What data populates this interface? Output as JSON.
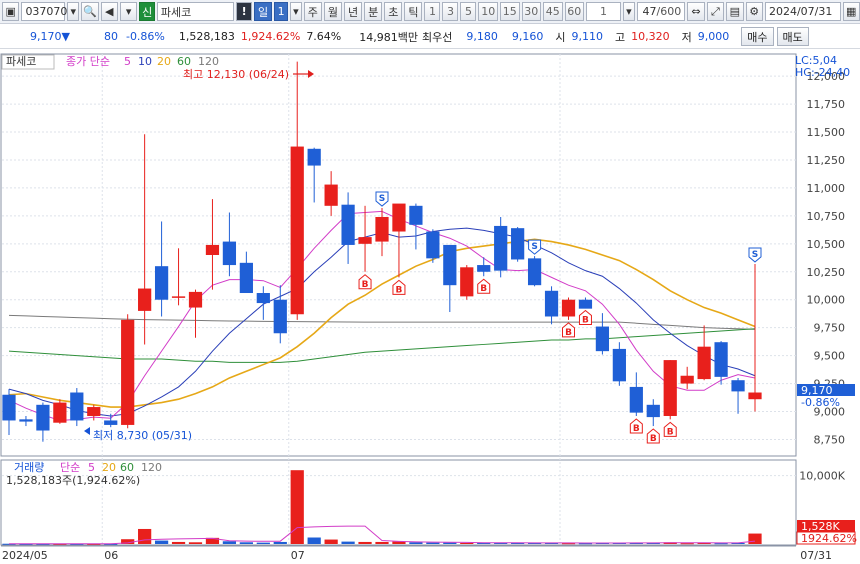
{
  "toolbar": {
    "code": "037070",
    "stock_tag": "신",
    "stock_name": "파세코",
    "period_selected": "일",
    "period_count": "1",
    "periods": [
      "주",
      "월",
      "년",
      "분",
      "초",
      "틱"
    ],
    "minutes": [
      "1",
      "3",
      "5",
      "10",
      "15",
      "30",
      "45",
      "60"
    ],
    "minute_value": "1",
    "count_display": "47",
    "count_max": "/600",
    "date": "2024/07/31"
  },
  "quote": {
    "price": "9,170",
    "arrow": "▼",
    "change": "80",
    "change_pct": "-0.86%",
    "volume": "1,528,183",
    "volume_ratio": "1,924.62%",
    "turnover": "7.64%",
    "amount": "14,981백만",
    "best_ask_label": "최우선",
    "best_ask": "9,180",
    "best_bid": "9,160",
    "open_label": "시",
    "open": "9,110",
    "high_label": "고",
    "high": "10,320",
    "low_label": "저",
    "low": "9,000",
    "buy_label": "매수",
    "sell_label": "매도"
  },
  "legend": {
    "name": "파세코",
    "ma_label": "종가 단순",
    "ma5": "5",
    "ma10": "10",
    "ma20": "20",
    "ma60": "60",
    "ma120": "120",
    "lc": "LC:5,04",
    "hc": "HC:-24,40",
    "vol_label": "거래량",
    "vol_ma_label": "단순",
    "vol_info": "1,528,183주(1,924.62%)"
  },
  "annotations": {
    "high": "최고 12,130 (06/24)",
    "low": "최저 8,730 (05/31)",
    "price_tag": "9,170",
    "pct_tag": "-0.86%",
    "vol_tag": "1,528K",
    "vol_pct_tag": "1924.62%"
  },
  "colors": {
    "up": "#e8201c",
    "down": "#1f5fd6",
    "ma5": "#d23cc8",
    "ma10": "#2a3fb8",
    "ma20": "#e6a817",
    "ma60": "#2f8f3a",
    "ma120": "#7a7a7a"
  },
  "chart_data": {
    "type": "candlestick",
    "x_labels": [
      "2024/05",
      "06",
      "07",
      "07/31"
    ],
    "y_ticks": [
      8750,
      9000,
      9250,
      9500,
      9750,
      10000,
      10250,
      10500,
      10750,
      11000,
      11250,
      11500,
      11750,
      12000
    ],
    "y_range": [
      8620,
      12180
    ],
    "candles": [
      {
        "o": 9150,
        "h": 9200,
        "l": 8790,
        "c": 8920
      },
      {
        "o": 8930,
        "h": 8960,
        "l": 8870,
        "c": 8910
      },
      {
        "o": 9060,
        "h": 9080,
        "l": 8730,
        "c": 8830
      },
      {
        "o": 8900,
        "h": 9110,
        "l": 8890,
        "c": 9080
      },
      {
        "o": 9170,
        "h": 9210,
        "l": 8870,
        "c": 8920
      },
      {
        "o": 8960,
        "h": 9060,
        "l": 8920,
        "c": 9040
      },
      {
        "o": 8920,
        "h": 8980,
        "l": 8860,
        "c": 8880
      },
      {
        "o": 8880,
        "h": 9870,
        "l": 8850,
        "c": 9820
      },
      {
        "o": 9900,
        "h": 11480,
        "l": 9600,
        "c": 10100
      },
      {
        "o": 10300,
        "h": 10700,
        "l": 9850,
        "c": 10000
      },
      {
        "o": 10020,
        "h": 10460,
        "l": 9950,
        "c": 10030
      },
      {
        "o": 9930,
        "h": 10090,
        "l": 9660,
        "c": 10070
      },
      {
        "o": 10400,
        "h": 10900,
        "l": 10090,
        "c": 10490
      },
      {
        "o": 10520,
        "h": 10780,
        "l": 10210,
        "c": 10310
      },
      {
        "o": 10330,
        "h": 10430,
        "l": 10100,
        "c": 10060
      },
      {
        "o": 10060,
        "h": 10120,
        "l": 9820,
        "c": 9970
      },
      {
        "o": 10000,
        "h": 10130,
        "l": 9610,
        "c": 9700
      },
      {
        "o": 9870,
        "h": 12130,
        "l": 9820,
        "c": 11370
      },
      {
        "o": 11350,
        "h": 11360,
        "l": 10870,
        "c": 11200
      },
      {
        "o": 10840,
        "h": 11150,
        "l": 10750,
        "c": 11030
      },
      {
        "o": 10850,
        "h": 10960,
        "l": 10320,
        "c": 10490
      },
      {
        "o": 10500,
        "h": 10840,
        "l": 10250,
        "c": 10560
      },
      {
        "o": 10520,
        "h": 10820,
        "l": 10390,
        "c": 10740
      },
      {
        "o": 10610,
        "h": 10850,
        "l": 10200,
        "c": 10860
      },
      {
        "o": 10840,
        "h": 10860,
        "l": 10450,
        "c": 10670
      },
      {
        "o": 10610,
        "h": 10630,
        "l": 10330,
        "c": 10370
      },
      {
        "o": 10490,
        "h": 10490,
        "l": 9890,
        "c": 10130
      },
      {
        "o": 10030,
        "h": 10310,
        "l": 10000,
        "c": 10290
      },
      {
        "o": 10310,
        "h": 10380,
        "l": 10210,
        "c": 10250
      },
      {
        "o": 10660,
        "h": 10740,
        "l": 10200,
        "c": 10260
      },
      {
        "o": 10640,
        "h": 10650,
        "l": 10340,
        "c": 10360
      },
      {
        "o": 10370,
        "h": 10390,
        "l": 10120,
        "c": 10130
      },
      {
        "o": 10080,
        "h": 10120,
        "l": 9780,
        "c": 9850
      },
      {
        "o": 9850,
        "h": 10020,
        "l": 9820,
        "c": 10000
      },
      {
        "o": 10000,
        "h": 10020,
        "l": 9930,
        "c": 9920
      },
      {
        "o": 9760,
        "h": 9880,
        "l": 9510,
        "c": 9540
      },
      {
        "o": 9560,
        "h": 9620,
        "l": 9230,
        "c": 9270
      },
      {
        "o": 9220,
        "h": 9350,
        "l": 8960,
        "c": 8990
      },
      {
        "o": 9060,
        "h": 9110,
        "l": 8870,
        "c": 8950
      },
      {
        "o": 8960,
        "h": 9460,
        "l": 8930,
        "c": 9460
      },
      {
        "o": 9250,
        "h": 9400,
        "l": 9200,
        "c": 9320
      },
      {
        "o": 9290,
        "h": 9770,
        "l": 9280,
        "c": 9580
      },
      {
        "o": 9620,
        "h": 9630,
        "l": 9240,
        "c": 9310
      },
      {
        "o": 9280,
        "h": 9300,
        "l": 8980,
        "c": 9180
      },
      {
        "o": 9110,
        "h": 10320,
        "l": 9000,
        "c": 9170
      }
    ],
    "signals": [
      {
        "i": 22,
        "type": "S",
        "pos": "above"
      },
      {
        "i": 21,
        "type": "B",
        "pos": "below"
      },
      {
        "i": 23,
        "type": "B",
        "pos": "below"
      },
      {
        "i": 28,
        "type": "B",
        "pos": "below"
      },
      {
        "i": 31,
        "type": "S",
        "pos": "above"
      },
      {
        "i": 33,
        "type": "B",
        "pos": "below"
      },
      {
        "i": 34,
        "type": "B",
        "pos": "below"
      },
      {
        "i": 37,
        "type": "B",
        "pos": "below"
      },
      {
        "i": 38,
        "type": "B",
        "pos": "below"
      },
      {
        "i": 39,
        "type": "B",
        "pos": "below"
      },
      {
        "i": 44,
        "type": "S",
        "pos": "above"
      }
    ],
    "ma5": [
      9100,
      9030,
      8970,
      8920,
      8930,
      8950,
      8940,
      9080,
      9320,
      9540,
      9760,
      9990,
      10130,
      10180,
      10180,
      10170,
      10110,
      10280,
      10460,
      10620,
      10770,
      10780,
      10790,
      10720,
      10660,
      10600,
      10550,
      10480,
      10370,
      10270,
      10260,
      10270,
      10200,
      10130,
      10080,
      9960,
      9780,
      9550,
      9360,
      9230,
      9190,
      9190,
      9280,
      9330,
      9300
    ],
    "ma10": [
      9200,
      9160,
      9100,
      9060,
      9010,
      8980,
      8960,
      8980,
      9050,
      9130,
      9220,
      9360,
      9540,
      9700,
      9830,
      9960,
      10030,
      10100,
      10250,
      10380,
      10520,
      10560,
      10600,
      10560,
      10570,
      10610,
      10630,
      10640,
      10620,
      10590,
      10560,
      10490,
      10420,
      10330,
      10260,
      10210,
      10100,
      9970,
      9820,
      9700,
      9590,
      9500,
      9420,
      9380,
      9320
    ],
    "ma20": [
      9150,
      9160,
      9130,
      9100,
      9080,
      9060,
      9040,
      9040,
      9060,
      9080,
      9110,
      9160,
      9220,
      9300,
      9360,
      9420,
      9480,
      9580,
      9700,
      9840,
      9960,
      10040,
      10140,
      10220,
      10300,
      10360,
      10430,
      10460,
      10480,
      10500,
      10520,
      10540,
      10520,
      10490,
      10450,
      10400,
      10350,
      10270,
      10180,
      10080,
      10000,
      9930,
      9880,
      9820,
      9760
    ],
    "ma60": [
      9540,
      9530,
      9520,
      9510,
      9500,
      9490,
      9480,
      9470,
      9470,
      9470,
      9460,
      9450,
      9450,
      9440,
      9440,
      9440,
      9440,
      9450,
      9470,
      9490,
      9510,
      9530,
      9540,
      9550,
      9560,
      9570,
      9580,
      9590,
      9600,
      9610,
      9620,
      9630,
      9640,
      9640,
      9650,
      9650,
      9660,
      9670,
      9680,
      9690,
      9700,
      9710,
      9720,
      9730,
      9740
    ],
    "ma120": [
      9860,
      9855,
      9850,
      9845,
      9840,
      9835,
      9830,
      9825,
      9822,
      9820,
      9818,
      9815,
      9812,
      9810,
      9808,
      9806,
      9805,
      9804,
      9803,
      9802,
      9801,
      9800,
      9800,
      9800,
      9800,
      9800,
      9800,
      9800,
      9800,
      9800,
      9800,
      9800,
      9800,
      9800,
      9800,
      9800,
      9800,
      9790,
      9780,
      9770,
      9760,
      9750,
      9745,
      9740,
      9735
    ],
    "volume": [
      40,
      30,
      30,
      35,
      30,
      30,
      30,
      700,
      2200,
      500,
      300,
      250,
      900,
      400,
      250,
      200,
      300,
      10800,
      950,
      650,
      350,
      300,
      300,
      350,
      250,
      200,
      200,
      150,
      150,
      200,
      200,
      150,
      150,
      120,
      120,
      200,
      150,
      200,
      150,
      250,
      120,
      150,
      120,
      150,
      1528
    ],
    "volume_max": 12000
  }
}
